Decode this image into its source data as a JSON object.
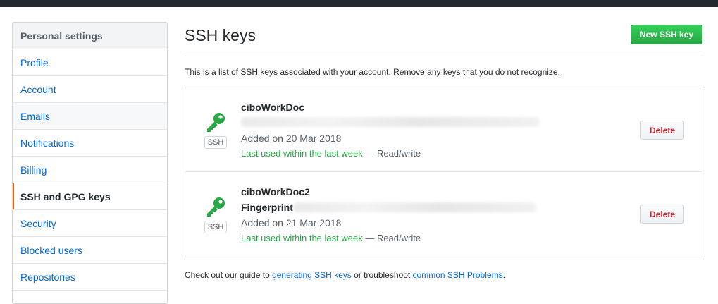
{
  "sidebar": {
    "header": "Personal settings",
    "items": [
      {
        "label": "Profile"
      },
      {
        "label": "Account"
      },
      {
        "label": "Emails"
      },
      {
        "label": "Notifications"
      },
      {
        "label": "Billing"
      },
      {
        "label": "SSH and GPG keys"
      },
      {
        "label": "Security"
      },
      {
        "label": "Blocked users"
      },
      {
        "label": "Repositories"
      }
    ],
    "selected": "SSH and GPG keys"
  },
  "main": {
    "title": "SSH keys",
    "new_key_label": "New SSH key",
    "intro": "This is a list of SSH keys associated with your account. Remove any keys that you do not recognize.",
    "keys": [
      {
        "title": "ciboWorkDoc",
        "fingerprint_label": "",
        "badge": "SSH",
        "added": "Added on 20 Mar 2018",
        "last_used": "Last used within the last week",
        "access": " — Read/write",
        "delete_label": "Delete"
      },
      {
        "title": "ciboWorkDoc2",
        "fingerprint_label": "Fingerprint",
        "badge": "SSH",
        "added": "Added on 21 Mar 2018",
        "last_used": "Last used within the last week",
        "access": " — Read/write",
        "delete_label": "Delete"
      }
    ],
    "footer": {
      "prefix": "Check out our guide to ",
      "link1": "generating SSH keys",
      "middle": " or troubleshoot ",
      "link2": "common SSH Problems",
      "suffix": "."
    }
  },
  "colors": {
    "accent_green": "#28a745",
    "link_blue": "#0366d6",
    "danger_red": "#cb2431",
    "selected_bar": "#e36209",
    "topbar": "#24292e"
  },
  "icons": {
    "key": "key-icon"
  }
}
